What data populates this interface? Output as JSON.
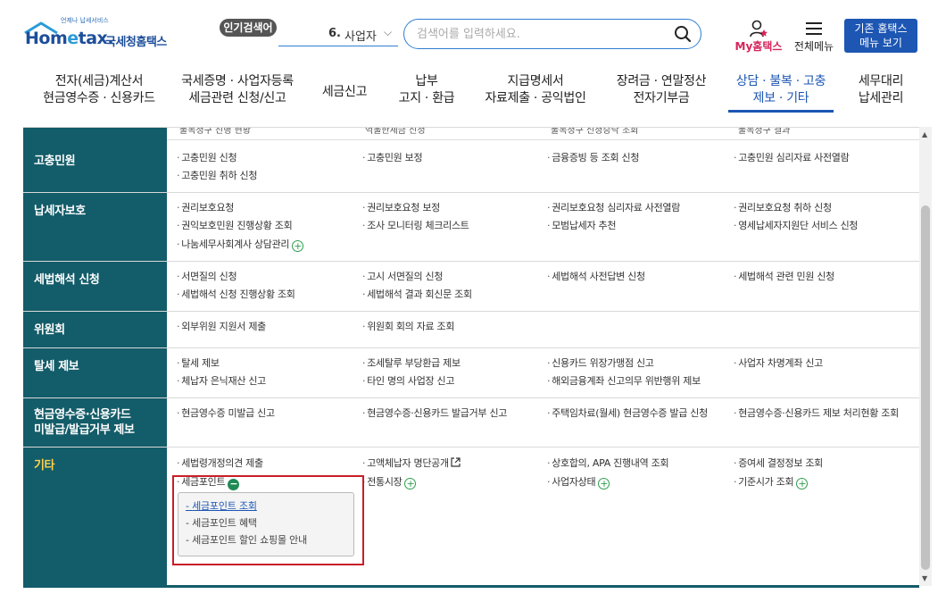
{
  "header": {
    "logo_tag": "언제나 납세서비스",
    "brand_prefix": "Hom",
    "brand_e": "e",
    "brand_suffix": "tax.",
    "brand_sub": "국세청홈택스",
    "popular_label": "인기검색어",
    "popular_rank": "6.",
    "popular_keyword": "사업자",
    "search_placeholder": "검색어를 입력하세요.",
    "my_label": "My홈택스",
    "allmenu_label": "전체메뉴",
    "oldhome_line1": "기존 홈택스",
    "oldhome_line2": "메뉴 보기"
  },
  "nav": [
    {
      "l1": "전자(세금)계산서",
      "l2": "현금영수증 · 신용카드"
    },
    {
      "l1": "국세증명 · 사업자등록",
      "l2": "세금관련 신청/신고"
    },
    {
      "l1": "세금신고",
      "l2": ""
    },
    {
      "l1": "납부",
      "l2": "고지 · 환급"
    },
    {
      "l1": "지급명세서",
      "l2": "자료제출 · 공익법인"
    },
    {
      "l1": "장려금 · 연말정산",
      "l2": "전자기부금"
    },
    {
      "l1": "상담 · 불복 · 고충",
      "l2": "제보 · 기타"
    },
    {
      "l1": "세무대리",
      "l2": "납세관리"
    }
  ],
  "cut_row": [
    "불복청구 진행 현황",
    "억울한세금 신청",
    "불복청구 신청승낙 조회",
    "불복청구 결과"
  ],
  "categories": [
    {
      "title": "고충민원",
      "links": [
        "고충민원 신청",
        "고충민원 보정",
        "금융증빙 등 조회 신청",
        "고충민원 심리자료 사전열람",
        "고충민원 취하 신청"
      ]
    },
    {
      "title": "납세자보호",
      "links": [
        "권리보호요청",
        "권리보호요청 보정",
        "권리보호요청 심리자료 사전열람",
        "권리보호요청 취하 신청",
        "권익보호민원 진행상황 조회",
        "조사 모니터링 체크리스트",
        "모범납세자 추천",
        "영세납세자지원단 서비스 신청",
        "나눔세무사회계사 상담관리"
      ]
    },
    {
      "title": "세법해석 신청",
      "links": [
        "서면질의 신청",
        "고시 서면질의 신청",
        "세법해석 사전답변 신청",
        "세법해석 관련 민원 신청",
        "세법해석 신청 진행상황 조회",
        "세법해석 결과 회신문 조회"
      ]
    },
    {
      "title": "위원회",
      "links": [
        "외부위원 지원서 제출",
        "위원회 회의 자료 조회"
      ]
    },
    {
      "title": "탈세 제보",
      "links": [
        "탈세 제보",
        "조세탈루 부당환급 제보",
        "신용카드 위장가맹점 신고",
        "사업자 차명계좌 신고",
        "체납자 은닉재산 신고",
        "타인 명의 사업장 신고",
        "해외금융계좌 신고의무 위반행위 제보"
      ]
    },
    {
      "title1": "현금영수증·신용카드",
      "title2": "미발급/발급거부 제보",
      "links": [
        "현금영수증 미발급 신고",
        "현금영수증·신용카드 발급거부 신고",
        "주택임차료(월세) 현금영수증 발급 신청",
        "현금영수증·신용카드 제보 처리현황 조회"
      ]
    },
    {
      "title": "기타",
      "links": [
        "세법령개정의견 제출",
        "고액체납자 명단공개",
        "상호합의, APA 진행내역 조회",
        "증여세 결정정보 조회",
        "세금포인트",
        "전통시장",
        "사업자상태",
        "기준시가 조회"
      ]
    }
  ],
  "submenu": [
    "세금포인트 조회",
    "세금포인트 혜택",
    "세금포인트 할인 쇼핑몰 안내"
  ],
  "colors": {
    "accent": "#1d56b3",
    "sidebar": "#135c69",
    "highlight_box": "#c81e28",
    "sidebar_active": "#ffd24a"
  }
}
